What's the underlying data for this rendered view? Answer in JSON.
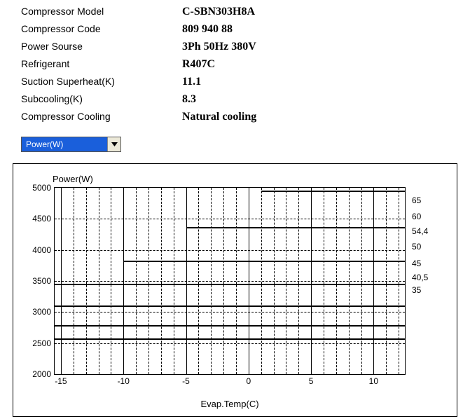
{
  "specs": [
    {
      "label": "Compressor Model",
      "value": "C-SBN303H8A"
    },
    {
      "label": "Compressor Code",
      "value": "809 940 88"
    },
    {
      "label": "Power Sourse",
      "value": "3Ph  50Hz  380V"
    },
    {
      "label": "Refrigerant",
      "value": "R407C"
    },
    {
      "label": "Suction Superheat(K)",
      "value": "11.1"
    },
    {
      "label": "Subcooling(K)",
      "value": "8.3"
    },
    {
      "label": "Compressor Cooling",
      "value": "Natural cooling"
    }
  ],
  "dropdown": {
    "selected": "Power(W)"
  },
  "chart_data": {
    "type": "line",
    "title": "Power(W)",
    "xlabel": "Evap.Temp(C)",
    "ylabel": "Power(W)",
    "xlim": [
      -15.5,
      12.5
    ],
    "ylim": [
      2000,
      5000
    ],
    "xticks": [
      -15,
      -10,
      -5,
      0,
      5,
      10
    ],
    "yticks": [
      2000,
      2500,
      3000,
      3500,
      4000,
      4500,
      5000
    ],
    "grid_y": [
      2500,
      3000,
      3500,
      4000,
      4500
    ],
    "series": [
      {
        "name": "65",
        "x": [
          1,
          12.5
        ],
        "y": [
          4950,
          4950
        ],
        "label_y": 4800
      },
      {
        "name": "60",
        "x": [
          -5,
          12.5
        ],
        "y": [
          4370,
          4370
        ],
        "label_y": 4540
      },
      {
        "name": "54,4",
        "x": [
          -10,
          12.5
        ],
        "y": [
          3830,
          3820
        ],
        "label_y": 4300
      },
      {
        "name": "50",
        "x": [
          -15.5,
          12.5
        ],
        "y": [
          3460,
          3520
        ],
        "label_y": 4050
      },
      {
        "name": "45",
        "x": [
          -15.5,
          12.5
        ],
        "y": [
          3100,
          3110
        ],
        "label_y": 3780
      },
      {
        "name": "40,5",
        "x": [
          -15.5,
          12.5
        ],
        "y": [
          2790,
          2800
        ],
        "label_y": 3560
      },
      {
        "name": "35",
        "x": [
          -15.5,
          12.5
        ],
        "y": [
          2570,
          2580
        ],
        "label_y": 3350
      }
    ]
  }
}
